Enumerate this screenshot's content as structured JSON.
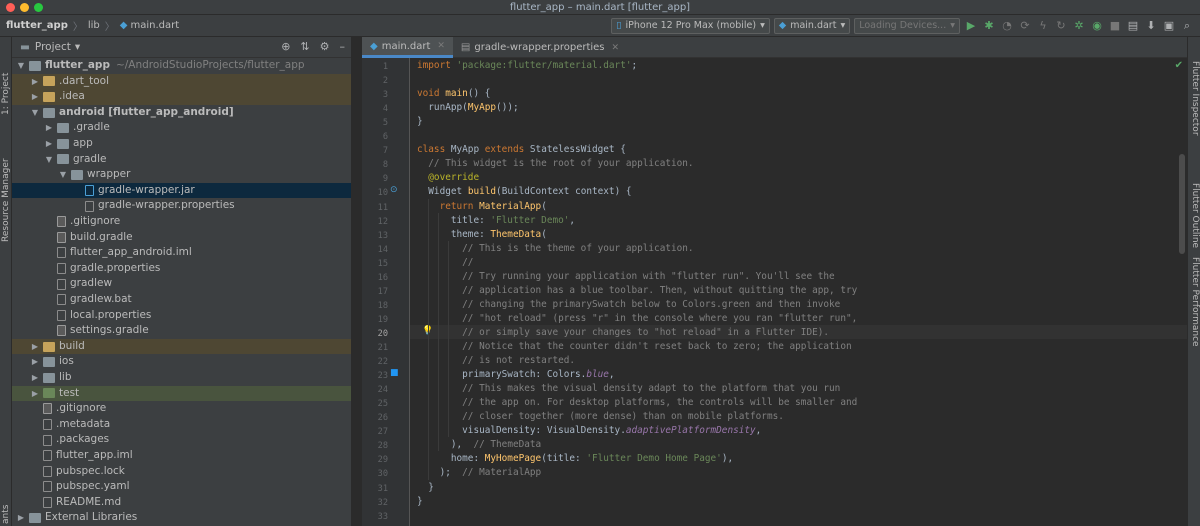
{
  "window": {
    "title": "flutter_app – main.dart [flutter_app]"
  },
  "nav": {
    "crumbs": [
      "flutter_app",
      "lib",
      "main.dart"
    ],
    "device": "iPhone 12 Pro Max (mobile)",
    "run_config": "main.dart",
    "devices_status": "Loading Devices..."
  },
  "stripes": {
    "left": [
      "1: Project",
      "Resource Manager",
      "ants"
    ],
    "right": [
      "Flutter Inspector",
      "Flutter Outline",
      "Flutter Performance"
    ]
  },
  "project": {
    "header": "Project",
    "tree": [
      {
        "label": "flutter_app",
        "hint": "~/AndroidStudioProjects/flutter_app",
        "depth": 0,
        "open": true,
        "icon": "folder",
        "bold": true
      },
      {
        "label": ".dart_tool",
        "depth": 1,
        "open": false,
        "icon": "folder-orange",
        "style": "excluded"
      },
      {
        "label": ".idea",
        "depth": 1,
        "open": false,
        "icon": "folder-orange",
        "style": "excluded"
      },
      {
        "label": "android [flutter_app_android]",
        "depth": 1,
        "open": true,
        "icon": "folder",
        "bold": true
      },
      {
        "label": ".gradle",
        "depth": 2,
        "open": false,
        "icon": "folder"
      },
      {
        "label": "app",
        "depth": 2,
        "open": false,
        "icon": "folder"
      },
      {
        "label": "gradle",
        "depth": 2,
        "open": true,
        "icon": "folder"
      },
      {
        "label": "wrapper",
        "depth": 3,
        "open": true,
        "icon": "folder"
      },
      {
        "label": "gradle-wrapper.jar",
        "depth": 4,
        "icon": "file-blue",
        "style": "selected"
      },
      {
        "label": "gradle-wrapper.properties",
        "depth": 4,
        "icon": "file"
      },
      {
        "label": ".gitignore",
        "depth": 2,
        "icon": "file-gray"
      },
      {
        "label": "build.gradle",
        "depth": 2,
        "icon": "file-gray"
      },
      {
        "label": "flutter_app_android.iml",
        "depth": 2,
        "icon": "file"
      },
      {
        "label": "gradle.properties",
        "depth": 2,
        "icon": "file"
      },
      {
        "label": "gradlew",
        "depth": 2,
        "icon": "file"
      },
      {
        "label": "gradlew.bat",
        "depth": 2,
        "icon": "file"
      },
      {
        "label": "local.properties",
        "depth": 2,
        "icon": "file"
      },
      {
        "label": "settings.gradle",
        "depth": 2,
        "icon": "file-gray"
      },
      {
        "label": "build",
        "depth": 1,
        "open": false,
        "icon": "folder-orange",
        "style": "excluded"
      },
      {
        "label": "ios",
        "depth": 1,
        "open": false,
        "icon": "folder"
      },
      {
        "label": "lib",
        "depth": 1,
        "open": false,
        "icon": "folder"
      },
      {
        "label": "test",
        "depth": 1,
        "open": false,
        "icon": "folder-green",
        "style": "test"
      },
      {
        "label": ".gitignore",
        "depth": 1,
        "icon": "file-gray"
      },
      {
        "label": ".metadata",
        "depth": 1,
        "icon": "file"
      },
      {
        "label": ".packages",
        "depth": 1,
        "icon": "file"
      },
      {
        "label": "flutter_app.iml",
        "depth": 1,
        "icon": "file"
      },
      {
        "label": "pubspec.lock",
        "depth": 1,
        "icon": "file"
      },
      {
        "label": "pubspec.yaml",
        "depth": 1,
        "icon": "file"
      },
      {
        "label": "README.md",
        "depth": 1,
        "icon": "file"
      },
      {
        "label": "External Libraries",
        "depth": 0,
        "open": false,
        "icon": "folder"
      }
    ]
  },
  "tabs": [
    {
      "label": "main.dart",
      "active": true
    },
    {
      "label": "gradle-wrapper.properties",
      "active": false
    }
  ],
  "editor": {
    "current_line": 20,
    "lines": [
      [
        [
          "kw",
          "import "
        ],
        [
          "str",
          "'package:flutter/material.dart'"
        ],
        [
          "",
          "; "
        ]
      ],
      [],
      [
        [
          "kw",
          "void "
        ],
        [
          "fn",
          "main"
        ],
        [
          "",
          "() {"
        ]
      ],
      [
        [
          "",
          "  runApp("
        ],
        [
          "fn",
          "MyApp"
        ],
        [
          "",
          "());"
        ]
      ],
      [
        [
          "",
          "}"
        ]
      ],
      [],
      [
        [
          "kw",
          "class "
        ],
        [
          "",
          "MyApp "
        ],
        [
          "kw",
          "extends "
        ],
        [
          "",
          "StatelessWidget {"
        ]
      ],
      [
        [
          "cmt",
          "  // This widget is the root of your application."
        ]
      ],
      [
        [
          "ann",
          "  @override"
        ]
      ],
      [
        [
          "",
          "  Widget "
        ],
        [
          "fn",
          "build"
        ],
        [
          "",
          "(BuildContext context) {"
        ]
      ],
      [
        [
          "kw",
          "    return "
        ],
        [
          "fn",
          "MaterialApp"
        ],
        [
          "",
          "("
        ]
      ],
      [
        [
          "",
          "      title: "
        ],
        [
          "str",
          "'Flutter Demo'"
        ],
        [
          "",
          ","
        ]
      ],
      [
        [
          "",
          "      theme: "
        ],
        [
          "fn",
          "ThemeData"
        ],
        [
          "",
          "("
        ]
      ],
      [
        [
          "cmt",
          "        // This is the theme of your application."
        ]
      ],
      [
        [
          "cmt",
          "        //"
        ]
      ],
      [
        [
          "cmt",
          "        // Try running your application with \"flutter run\". You'll see the"
        ]
      ],
      [
        [
          "cmt",
          "        // application has a blue toolbar. Then, without quitting the app, try"
        ]
      ],
      [
        [
          "cmt",
          "        // changing the primarySwatch below to Colors.green and then invoke"
        ]
      ],
      [
        [
          "cmt",
          "        // \"hot reload\" (press \"r\" in the console where you ran \"flutter run\","
        ]
      ],
      [
        [
          "cmt",
          "        // or simply save your changes to \"hot reload\" in a Flutter IDE)."
        ]
      ],
      [
        [
          "cmt",
          "        // Notice that the counter didn't reset back to zero; the application"
        ]
      ],
      [
        [
          "cmt",
          "        // is not restarted."
        ]
      ],
      [
        [
          "",
          "        primarySwatch: Colors."
        ],
        [
          "it",
          "blue"
        ],
        [
          "",
          ","
        ]
      ],
      [
        [
          "cmt",
          "        // This makes the visual density adapt to the platform that you run"
        ]
      ],
      [
        [
          "cmt",
          "        // the app on. For desktop platforms, the controls will be smaller and"
        ]
      ],
      [
        [
          "cmt",
          "        // closer together (more dense) than on mobile platforms."
        ]
      ],
      [
        [
          "",
          "        visualDensity: VisualDensity."
        ],
        [
          "it",
          "adaptivePlatformDensity"
        ],
        [
          "",
          ","
        ]
      ],
      [
        [
          "",
          "      ),  "
        ],
        [
          "cmt",
          "// ThemeData"
        ]
      ],
      [
        [
          "",
          "      home: "
        ],
        [
          "fn",
          "MyHomePage"
        ],
        [
          "",
          "(title: "
        ],
        [
          "str",
          "'Flutter Demo Home Page'"
        ],
        [
          "",
          "),"
        ]
      ],
      [
        [
          "",
          "    );  "
        ],
        [
          "cmt",
          "// MaterialApp"
        ]
      ],
      [
        [
          "",
          "  }"
        ]
      ],
      [
        [
          "",
          "}"
        ]
      ],
      []
    ]
  },
  "colors": {
    "accent": "#4a88c7",
    "keyword": "#cc7832",
    "string": "#6a8759",
    "comment": "#808080",
    "function": "#ffc66d",
    "annotation": "#bbb529"
  }
}
